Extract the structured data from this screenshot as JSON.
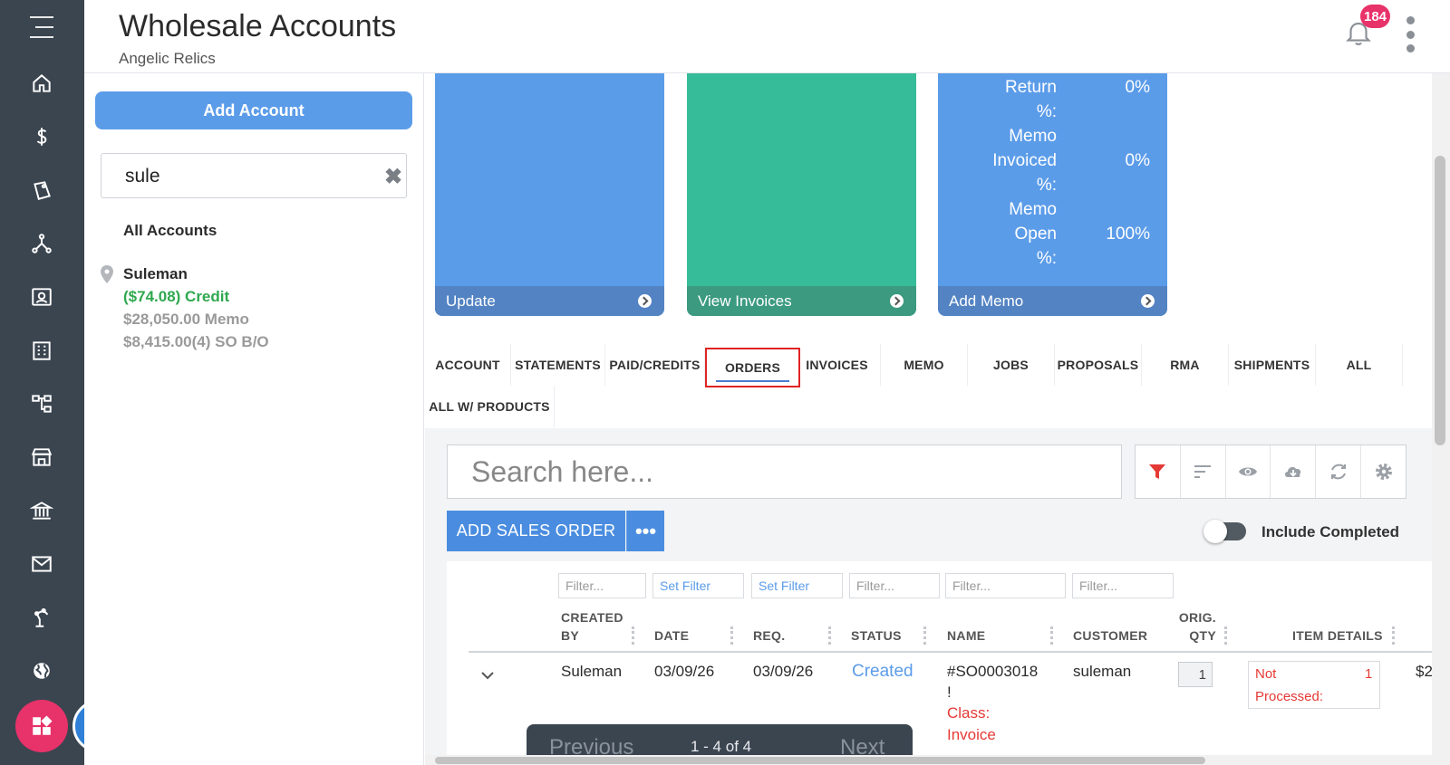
{
  "app": {
    "title": "Wholesale Accounts",
    "subtitle": "Angelic Relics",
    "notification_count": "184"
  },
  "rail": {
    "items": [
      "menu-icon",
      "home-icon",
      "dollar-icon",
      "tag-icon",
      "network-icon",
      "contact-card-icon",
      "building-icon",
      "hierarchy-icon",
      "store-icon",
      "bank-icon",
      "mail-icon",
      "robot-arm-icon",
      "globe-icon"
    ]
  },
  "left_panel": {
    "add_account_label": "Add Account",
    "search_value": "sule",
    "all_accounts_label": "All Accounts",
    "account": {
      "name": "Suleman",
      "credit": "($74.08) Credit",
      "memo": "$28,050.00 Memo",
      "so_bo": "$8,415.00(4) SO B/O"
    }
  },
  "cards": [
    {
      "footer": "Update",
      "color": "#5b9ce9",
      "footer_color": "#5383c3"
    },
    {
      "footer": "View Invoices",
      "color": "#36bc98",
      "footer_color": "#3b9a80"
    },
    {
      "footer": "Add Memo",
      "color": "#5b9ce9",
      "footer_color": "#5383c3",
      "stats": [
        {
          "l1": "Return",
          "l2": "%:",
          "value": "0%"
        },
        {
          "l1": "Memo",
          "l2": "Invoiced",
          "l3": "%:",
          "value": "0%"
        },
        {
          "l1": "Memo",
          "l2": "Open",
          "l3": "%:",
          "value": "100%"
        }
      ]
    }
  ],
  "tabs": [
    "ACCOUNT",
    "STATEMENTS",
    "PAID/CREDITS",
    "ORDERS",
    "INVOICES",
    "MEMO",
    "JOBS",
    "PROPOSALS",
    "RMA",
    "SHIPMENTS",
    "ALL",
    "ALL W/ PRODUCTS"
  ],
  "active_tab": "ORDERS",
  "grid": {
    "search_placeholder": "Search here...",
    "add_sales_order_label": "ADD SALES ORDER",
    "more_label": "•••",
    "include_completed_label": "Include Completed",
    "filters": [
      "Filter...",
      "Set Filter",
      "Set Filter",
      "Filter...",
      "Filter...",
      "Filter..."
    ],
    "columns": {
      "created_by_1": "CREATED",
      "created_by_2": "BY",
      "date": "DATE",
      "req": "REQ.",
      "status": "STATUS",
      "name": "NAME",
      "customer": "CUSTOMER",
      "orig_qty_1": "ORIG.",
      "orig_qty_2": "QTY",
      "item_details": "ITEM DETAILS"
    },
    "row": {
      "created_by": "Suleman",
      "date": "03/09/26",
      "req": "03/09/26",
      "status": "Created",
      "name_1": "#SO0003018",
      "name_2": "!",
      "class_1": "Class:",
      "class_2": "Invoice",
      "customer": "suleman",
      "qty": "1",
      "item_status_1": "Not",
      "item_status_2": "Processed:",
      "item_count": "1",
      "amount_partial": "$2"
    }
  },
  "pager": {
    "previous": "Previous",
    "count": "1 - 4 of 4",
    "next": "Next"
  },
  "colors": {
    "rail_bg": "#3b4550",
    "accent_blue": "#5b9ce9",
    "accent_green": "#36bc98",
    "credit_green": "#2fa84f",
    "badge_pink": "#e8326a",
    "status_blue": "#5b9ce9",
    "error_red": "#e53935"
  }
}
